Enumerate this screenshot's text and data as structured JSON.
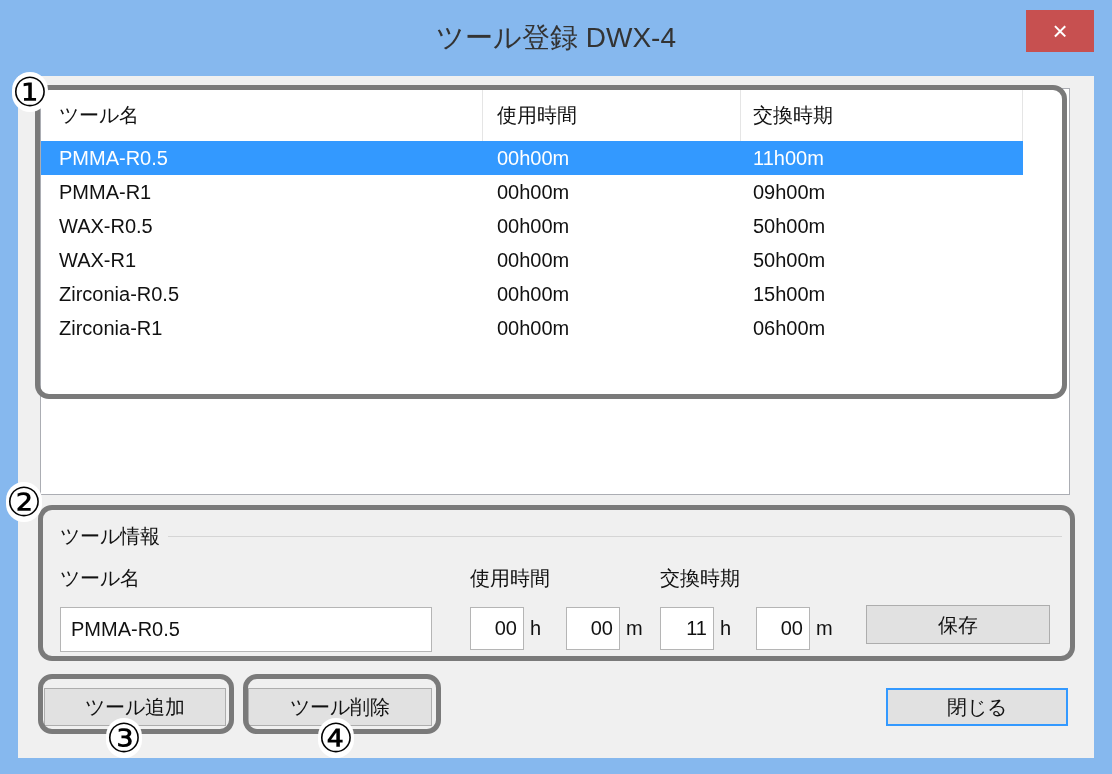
{
  "window": {
    "title": "ツール登録 DWX-4",
    "close": "×"
  },
  "tool_list": {
    "columns": [
      "ツール名",
      "使用時間",
      "交換時期"
    ],
    "rows": [
      {
        "cells": [
          "PMMA-R0.5",
          "00h00m",
          "11h00m"
        ],
        "selected": true
      },
      {
        "cells": [
          "PMMA-R1",
          "00h00m",
          "09h00m"
        ],
        "selected": false
      },
      {
        "cells": [
          "WAX-R0.5",
          "00h00m",
          "50h00m"
        ],
        "selected": false
      },
      {
        "cells": [
          "WAX-R1",
          "00h00m",
          "50h00m"
        ],
        "selected": false
      },
      {
        "cells": [
          "Zirconia-R0.5",
          "00h00m",
          "15h00m"
        ],
        "selected": false
      },
      {
        "cells": [
          "Zirconia-R1",
          "00h00m",
          "06h00m"
        ],
        "selected": false
      }
    ]
  },
  "tool_info": {
    "legend": "ツール情報",
    "name_label": "ツール名",
    "name_value": "PMMA-R0.5",
    "time_groups": [
      {
        "label": "使用時間",
        "fields": [
          {
            "value": "00",
            "unit": "h"
          },
          {
            "value": "00",
            "unit": "m"
          }
        ]
      },
      {
        "label": "交換時期",
        "fields": [
          {
            "value": "11",
            "unit": "h"
          },
          {
            "value": "00",
            "unit": "m"
          }
        ]
      }
    ],
    "save": "保存"
  },
  "buttons": {
    "add": "ツール追加",
    "delete": "ツール削除",
    "close": "閉じる"
  },
  "callouts": [
    {
      "number": "①"
    },
    {
      "number": "②"
    },
    {
      "number": "③"
    },
    {
      "number": "④"
    }
  ]
}
